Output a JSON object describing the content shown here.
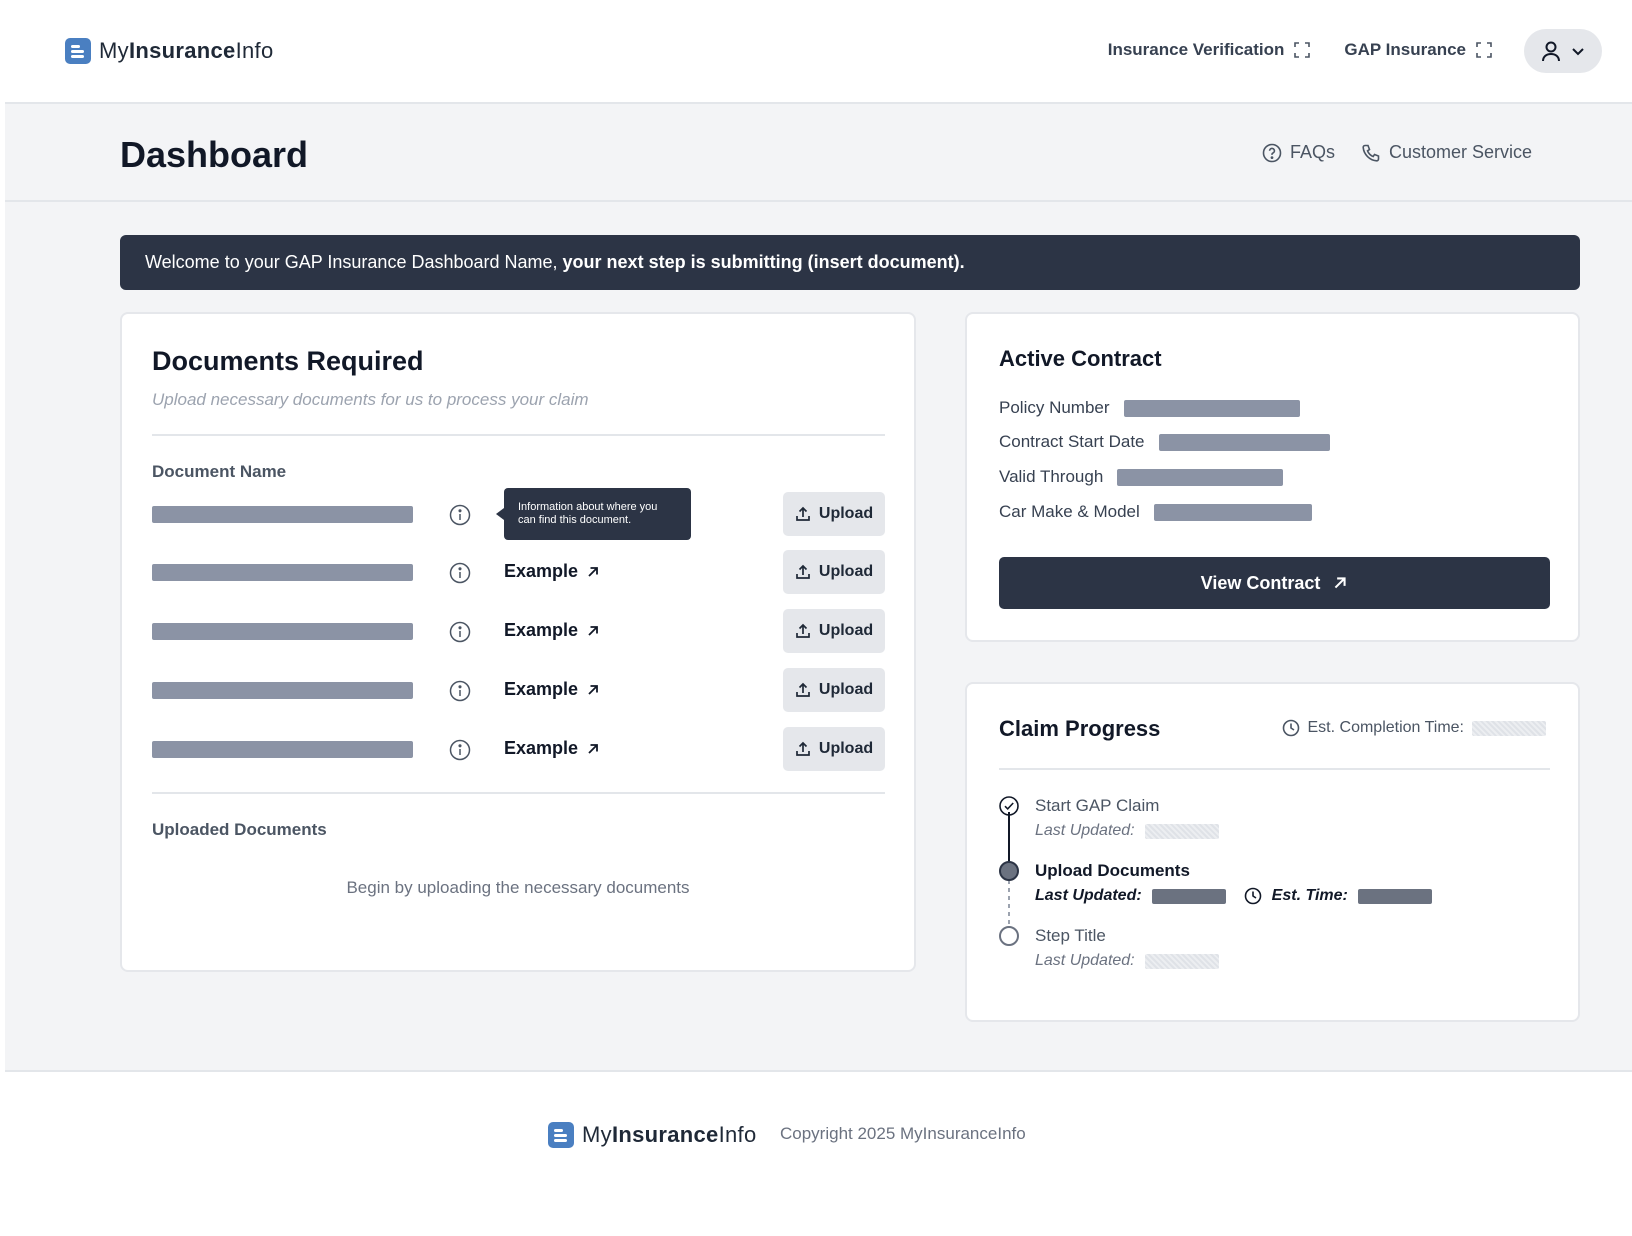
{
  "brand": {
    "name_light": "My",
    "name_bold": "Insurance",
    "name_end": "Info"
  },
  "topnav": {
    "links": [
      {
        "label": "Insurance Verification",
        "icon": "expand-icon"
      },
      {
        "label": "GAP Insurance",
        "icon": "expand-icon"
      }
    ],
    "user_menu": {
      "icon": "user-icon",
      "caret": "chevron-down-icon"
    }
  },
  "subheader": {
    "title": "Dashboard",
    "faqs_label": "FAQs",
    "customer_service_label": "Customer Service"
  },
  "banner": {
    "text": "Welcome to your GAP Insurance Dashboard Name,",
    "emphasis": "your next step is submitting (insert document)."
  },
  "documents": {
    "title": "Documents Required",
    "subtitle": "Upload necessary documents for us to process your claim",
    "column_label": "Document Name",
    "tooltip": "Information about where you can find this document.",
    "rows": [
      {
        "link_label": "",
        "upload_label": "Upload"
      },
      {
        "link_label": "Example",
        "upload_label": "Upload"
      },
      {
        "link_label": "Example",
        "upload_label": "Upload"
      },
      {
        "link_label": "Example",
        "upload_label": "Upload"
      },
      {
        "link_label": "Example",
        "upload_label": "Upload"
      }
    ],
    "uploaded_label": "Uploaded Documents",
    "empty_message": "Begin by uploading the necessary documents"
  },
  "contract": {
    "title": "Active Contract",
    "fields": [
      {
        "label": "Policy Number"
      },
      {
        "label": "Contract Start Date"
      },
      {
        "label": "Valid Through"
      },
      {
        "label": "Car Make & Model"
      }
    ],
    "button_label": "View Contract"
  },
  "progress": {
    "title": "Claim Progress",
    "est_label": "Est. Completion Time:",
    "steps": [
      {
        "title": "Start GAP Claim",
        "meta_label": "Last Updated:",
        "state": "complete"
      },
      {
        "title": "Upload Documents",
        "meta_label": "Last Updated:",
        "est_label": "Est. Time:",
        "state": "current"
      },
      {
        "title": "Step Title",
        "meta_label": "Last Updated:",
        "state": "pending"
      }
    ]
  },
  "footer": {
    "copyright": "Copyright 2025 MyInsuranceInfo"
  },
  "colors": {
    "primary_dark": "#2c3445",
    "brand_blue": "#4a7fc1",
    "placeholder_bar": "#8b93a5",
    "page_bg": "#f3f4f6"
  }
}
